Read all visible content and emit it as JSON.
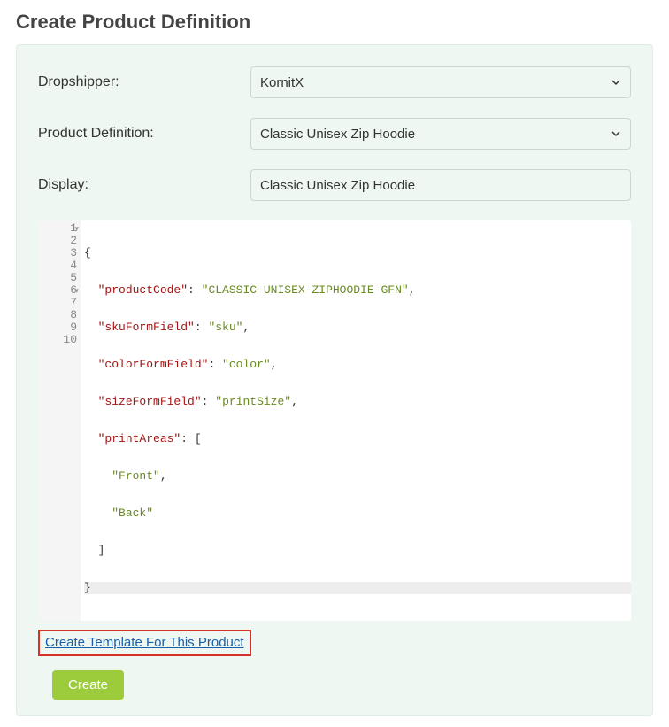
{
  "pageTitle": "Create Product Definition",
  "form": {
    "dropshipper": {
      "label": "Dropshipper:",
      "value": "KornitX"
    },
    "productDefinition": {
      "label": "Product Definition:",
      "value": "Classic Unisex Zip Hoodie"
    },
    "display": {
      "label": "Display:",
      "value": "Classic Unisex Zip Hoodie"
    }
  },
  "editor": {
    "lines": [
      "1",
      "2",
      "3",
      "4",
      "5",
      "6",
      "7",
      "8",
      "9",
      "10"
    ],
    "json": {
      "productCode": "CLASSIC-UNISEX-ZIPHOODIE-GFN",
      "skuFormField": "sku",
      "colorFormField": "color",
      "sizeFormField": "printSize",
      "printAreas": [
        "Front",
        "Back"
      ]
    }
  },
  "actions": {
    "createTemplateLink": "Create Template For This Product",
    "createButton": "Create"
  }
}
